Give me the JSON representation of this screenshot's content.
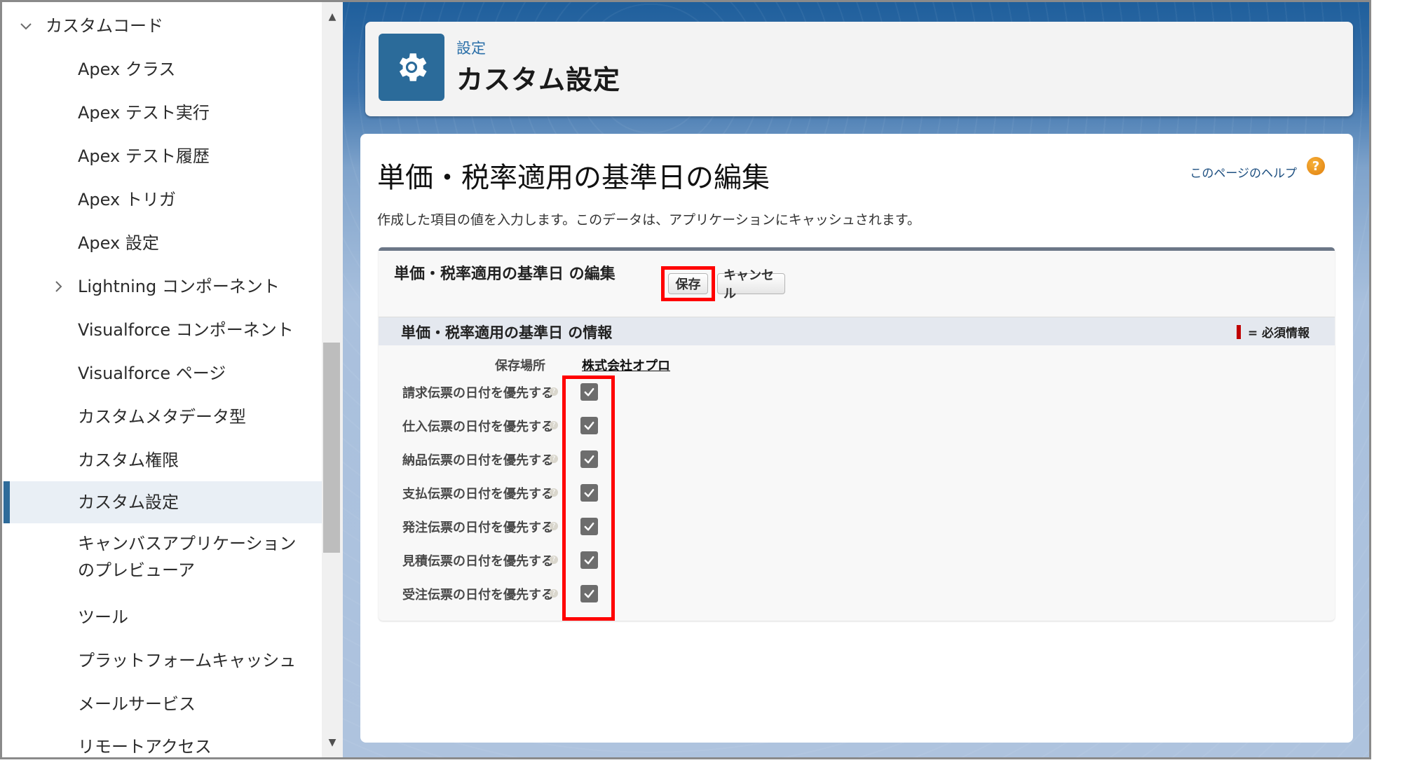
{
  "sidebar": {
    "section": {
      "label": "カスタムコード",
      "expanded": true
    },
    "items": [
      {
        "label": "Apex クラス"
      },
      {
        "label": "Apex テスト実行"
      },
      {
        "label": "Apex テスト履歴"
      },
      {
        "label": "Apex トリガ"
      },
      {
        "label": "Apex 設定"
      },
      {
        "label": "Lightning コンポーネント",
        "expandable": true
      },
      {
        "label": "Visualforce コンポーネント"
      },
      {
        "label": "Visualforce ページ"
      },
      {
        "label": "カスタムメタデータ型"
      },
      {
        "label": "カスタム権限"
      },
      {
        "label": "カスタム設定",
        "selected": true
      },
      {
        "label": "キャンバスアプリケーション",
        "label2": "のプレビューア"
      },
      {
        "label": "ツール"
      },
      {
        "label": "プラットフォームキャッシュ"
      },
      {
        "label": "メールサービス"
      },
      {
        "label": "リモートアクセス"
      }
    ]
  },
  "header": {
    "icon": "gear-icon",
    "breadcrumb": "設定",
    "title": "カスタム設定"
  },
  "page": {
    "title": "単価・税率適用の基準日の編集",
    "help_link": "このページのヘルプ",
    "description": "作成した項目の値を入力します。このデータは、アプリケーションにキャッシュされます。"
  },
  "edit_block": {
    "title": "単価・税率適用の基準日 の編集",
    "save_label": "保存",
    "cancel_label": "キャンセル",
    "section_title": "単価・税率適用の基準日 の情報",
    "required_legend": "= 必須情報",
    "location": {
      "label": "保存場所",
      "value": "株式会社オプロ"
    },
    "fields": [
      {
        "label": "請求伝票の日付を優先する",
        "checked": true
      },
      {
        "label": "仕入伝票の日付を優先する",
        "checked": true
      },
      {
        "label": "納品伝票の日付を優先する",
        "checked": true
      },
      {
        "label": "支払伝票の日付を優先する",
        "checked": true
      },
      {
        "label": "発注伝票の日付を優先する",
        "checked": true
      },
      {
        "label": "見積伝票の日付を優先する",
        "checked": true
      },
      {
        "label": "受注伝票の日付を優先する",
        "checked": true
      }
    ]
  },
  "colors": {
    "accent": "#2b6b9a",
    "highlight": "#ff0000",
    "required": "#c00000",
    "help": "#e88a12"
  }
}
